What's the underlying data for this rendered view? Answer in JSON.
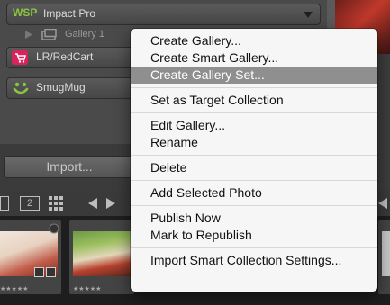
{
  "services": [
    {
      "name": "Impact Pro",
      "logo_text": "WSP"
    },
    {
      "name": "LR/RedCart"
    },
    {
      "name": "SmugMug"
    }
  ],
  "gallery_item": {
    "label": "Gallery 1"
  },
  "import_button": {
    "label": "Import..."
  },
  "toolbar": {
    "view_number": "2"
  },
  "filmstrip": {
    "stars": "★★★★★"
  },
  "context_menu": {
    "groups": [
      [
        "Create Gallery...",
        "Create Smart Gallery...",
        "Create Gallery Set..."
      ],
      [
        "Set as Target Collection"
      ],
      [
        "Edit Gallery...",
        "Rename"
      ],
      [
        "Delete"
      ],
      [
        "Add Selected Photo"
      ],
      [
        "Publish Now",
        "Mark to Republish"
      ],
      [
        "Import Smart Collection Settings..."
      ]
    ],
    "highlighted": "Create Gallery Set..."
  },
  "colors": {
    "menu_bg": "#f6f6f6",
    "menu_highlight": "#8f8f8f",
    "wsp_green": "#8bc53f",
    "panel_bg": "#4a4a4a"
  }
}
